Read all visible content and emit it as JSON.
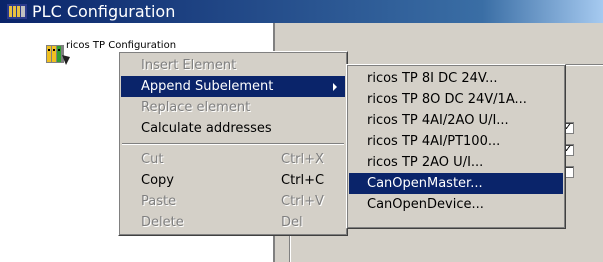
{
  "window": {
    "title": "PLC Configuration",
    "icon": "plc-config-icon"
  },
  "tree": {
    "root_label": "ricos TP Configuration",
    "root_icon": "plc-device-icon"
  },
  "context_menu": {
    "items": [
      {
        "label": "Insert Element",
        "shortcut": "",
        "disabled": true
      },
      {
        "label": "Append Subelement",
        "shortcut": "",
        "disabled": false,
        "highlighted": true,
        "has_submenu": true
      },
      {
        "label": "Replace element",
        "shortcut": "",
        "disabled": true
      },
      {
        "label": "Calculate addresses",
        "shortcut": "",
        "disabled": false
      },
      {
        "label": "Cut",
        "shortcut": "Ctrl+X",
        "disabled": true
      },
      {
        "label": "Copy",
        "shortcut": "Ctrl+C",
        "disabled": false
      },
      {
        "label": "Paste",
        "shortcut": "Ctrl+V",
        "disabled": true
      },
      {
        "label": "Delete",
        "shortcut": "Del",
        "disabled": true
      }
    ]
  },
  "submenu": {
    "items": [
      {
        "label": "ricos TP 8I DC 24V..."
      },
      {
        "label": "ricos TP 8O DC 24V/1A..."
      },
      {
        "label": "ricos TP 4AI/2AO U/I..."
      },
      {
        "label": "ricos TP 4AI/PT100..."
      },
      {
        "label": "ricos TP 2AO U/I..."
      },
      {
        "label": "CanOpenMaster...",
        "highlighted": true
      },
      {
        "label": "CanOpenDevice..."
      }
    ]
  },
  "checkboxes": [
    {
      "checked": true,
      "mark": "✓"
    },
    {
      "checked": true,
      "mark": "✓"
    },
    {
      "checked": false,
      "mark": ""
    }
  ],
  "colors": {
    "highlight": "#0a246a",
    "titlebar": "#0a246a",
    "face": "#d4d0c8"
  }
}
